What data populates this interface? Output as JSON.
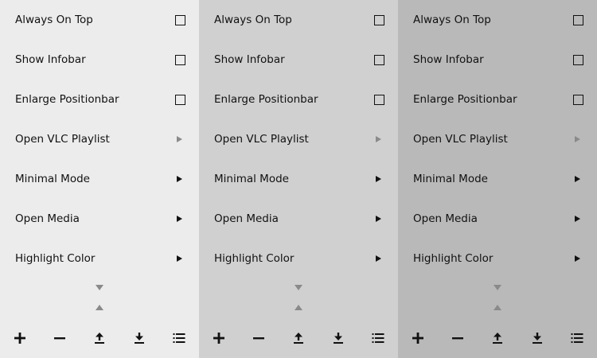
{
  "panels": [
    {
      "background": "#ececec",
      "items": [
        {
          "label": "Always On Top",
          "control": "checkbox"
        },
        {
          "label": "Show Infobar",
          "control": "checkbox"
        },
        {
          "label": "Enlarge Positionbar",
          "control": "checkbox"
        },
        {
          "label": "Open VLC Playlist",
          "control": "submenu-disabled"
        },
        {
          "label": "Minimal Mode",
          "control": "submenu"
        },
        {
          "label": "Open Media",
          "control": "submenu"
        },
        {
          "label": "Highlight Color",
          "control": "submenu"
        }
      ]
    },
    {
      "background": "#d0d0d0",
      "items": [
        {
          "label": "Always On Top",
          "control": "checkbox"
        },
        {
          "label": "Show Infobar",
          "control": "checkbox"
        },
        {
          "label": "Enlarge Positionbar",
          "control": "checkbox"
        },
        {
          "label": "Open VLC Playlist",
          "control": "submenu-disabled"
        },
        {
          "label": "Minimal Mode",
          "control": "submenu"
        },
        {
          "label": "Open Media",
          "control": "submenu"
        },
        {
          "label": "Highlight Color",
          "control": "submenu"
        }
      ]
    },
    {
      "background": "#b9b9b9",
      "items": [
        {
          "label": "Always On Top",
          "control": "checkbox"
        },
        {
          "label": "Show Infobar",
          "control": "checkbox"
        },
        {
          "label": "Enlarge Positionbar",
          "control": "checkbox"
        },
        {
          "label": "Open VLC Playlist",
          "control": "submenu-disabled"
        },
        {
          "label": "Minimal Mode",
          "control": "submenu"
        },
        {
          "label": "Open Media",
          "control": "submenu"
        },
        {
          "label": "Highlight Color",
          "control": "submenu"
        }
      ]
    }
  ],
  "toolbar_icons": [
    "plus-icon",
    "minus-icon",
    "upload-icon",
    "download-icon",
    "list-icon"
  ],
  "colors": {
    "text": "#111111",
    "disabled_arrow": "#8a8a8a"
  }
}
